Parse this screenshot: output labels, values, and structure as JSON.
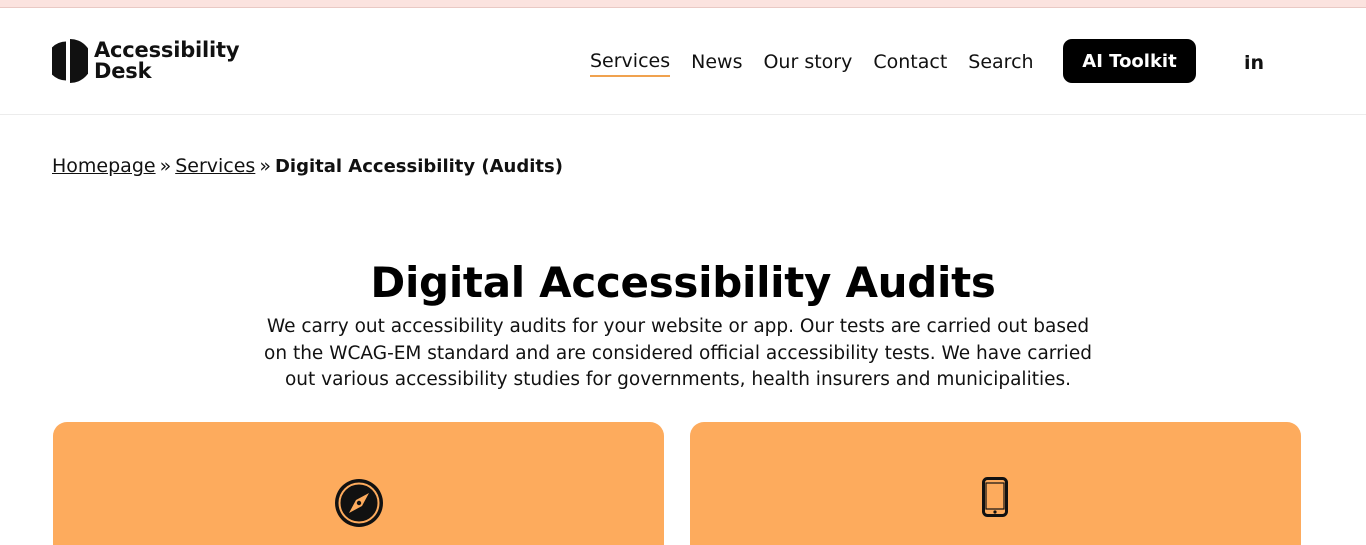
{
  "brand": {
    "line1": "Accessibility",
    "line2": "Desk"
  },
  "nav": {
    "items": [
      {
        "label": "Services",
        "active": true
      },
      {
        "label": "News"
      },
      {
        "label": "Our story"
      },
      {
        "label": "Contact"
      },
      {
        "label": "Search"
      }
    ],
    "cta_label": "AI Toolkit",
    "social_label": "in"
  },
  "breadcrumb": {
    "home": "Homepage",
    "separator": "»",
    "section": "Services",
    "current": "Digital Accessibility (Audits)"
  },
  "main": {
    "title": "Digital Accessibility Audits",
    "intro": "We carry out accessibility audits for your website or app. Our tests are carried out based on the WCAG-EM standard and are considered official accessibility tests. We have carried out various accessibility studies for governments, health insurers and municipalities."
  },
  "cards": [
    {
      "icon": "compass-icon",
      "color": "#fdab5d"
    },
    {
      "icon": "smartphone-icon",
      "color": "#fdab5d"
    }
  ],
  "colors": {
    "accent": "#f0a24f",
    "card": "#fdab5d",
    "button": "#000000",
    "top_strip": "#fbe3df"
  }
}
